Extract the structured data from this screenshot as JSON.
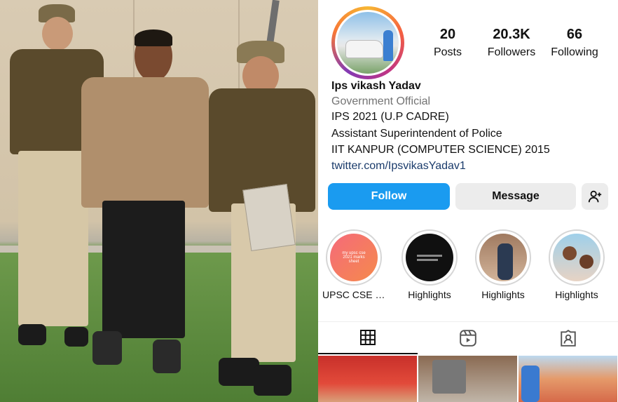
{
  "profile": {
    "name": "Ips vikash Yadav",
    "category": "Government Official",
    "bio": [
      "IPS 2021 (U.P CADRE)",
      "Assistant Superintendent of Police",
      "IIT KANPUR (COMPUTER SCIENCE) 2015"
    ],
    "link": "twitter.com/IpsvikasYadav1"
  },
  "stats": [
    {
      "value": "20",
      "label": "Posts"
    },
    {
      "value": "20.3K",
      "label": "Followers"
    },
    {
      "value": "66",
      "label": "Following"
    }
  ],
  "actions": {
    "follow_label": "Follow",
    "message_label": "Message",
    "add_user_icon": "add-person-icon"
  },
  "highlights": [
    {
      "label": "UPSC CSE M...",
      "preview_text": "my upsc cse 2021 marks sheet"
    },
    {
      "label": "Highlights"
    },
    {
      "label": "Highlights"
    },
    {
      "label": "Highlights"
    }
  ],
  "tabs": [
    "grid-icon",
    "reels-icon",
    "tagged-icon"
  ],
  "colors": {
    "accent": "#1a9bf0",
    "link": "#1a3b6b",
    "muted": "#737373",
    "button_bg": "#ececec"
  }
}
